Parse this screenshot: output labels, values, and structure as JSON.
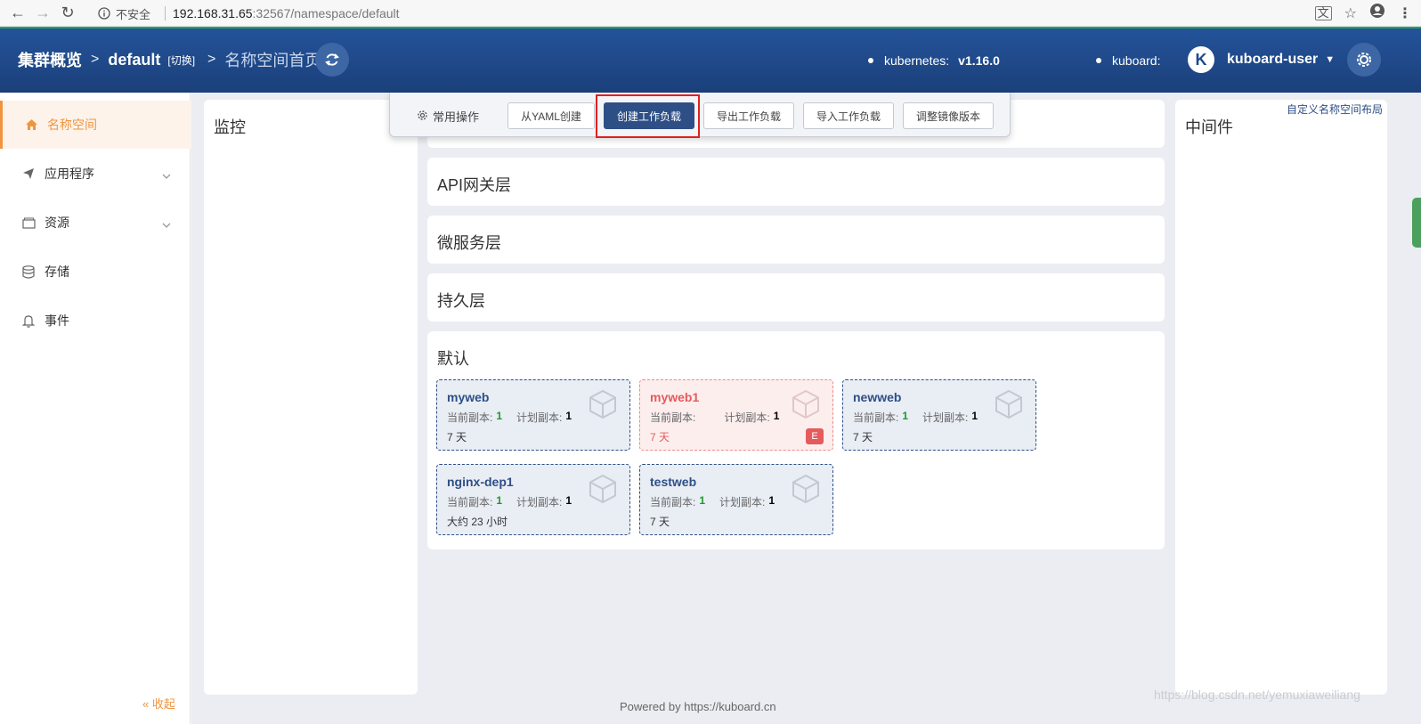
{
  "browser": {
    "security_label": "不安全",
    "url_host": "192.168.31.65",
    "url_path": ":32567/namespace/default"
  },
  "header": {
    "breadcrumb_cluster": "集群概览",
    "breadcrumb_namespace": "default",
    "switch_label": "[切换]",
    "breadcrumb_page": "名称空间首页",
    "kubernetes_label": "kubernetes:",
    "kubernetes_version": "v1.16.0",
    "kuboard_label": "kuboard:",
    "avatar_letter": "K",
    "user_name": "kuboard-user"
  },
  "sidebar": {
    "items": [
      {
        "label": "名称空间",
        "icon": "home-icon",
        "active": true
      },
      {
        "label": "应用程序",
        "icon": "send-icon",
        "has_children": true
      },
      {
        "label": "资源",
        "icon": "box-icon",
        "has_children": true
      },
      {
        "label": "存储",
        "icon": "database-icon"
      },
      {
        "label": "事件",
        "icon": "bell-icon"
      }
    ],
    "collapse_label": "« 收起"
  },
  "toolbar": {
    "label": "常用操作",
    "buttons": [
      "从YAML创建",
      "创建工作负载",
      "导出工作负载",
      "导入工作负载",
      "调整镜像版本"
    ]
  },
  "panels": {
    "monitor": "监控",
    "gateway": "API网关层",
    "microservice": "微服务层",
    "persistence": "持久层",
    "default": "默认",
    "middleware": "中间件",
    "custom_layout_link": "自定义名称空间布局"
  },
  "workloads": [
    {
      "name": "myweb",
      "current_label": "当前副本:",
      "current": "1",
      "planned_label": "计划副本:",
      "planned": "1",
      "age": "7 天",
      "error": false
    },
    {
      "name": "myweb1",
      "current_label": "当前副本:",
      "current": "",
      "planned_label": "计划副本:",
      "planned": "1",
      "age": "7 天",
      "error": true,
      "badge": "E"
    },
    {
      "name": "newweb",
      "current_label": "当前副本:",
      "current": "1",
      "planned_label": "计划副本:",
      "planned": "1",
      "age": "7 天",
      "error": false
    },
    {
      "name": "nginx-dep1",
      "current_label": "当前副本:",
      "current": "1",
      "planned_label": "计划副本:",
      "planned": "1",
      "age": "大约 23 小时",
      "error": false
    },
    {
      "name": "testweb",
      "current_label": "当前副本:",
      "current": "1",
      "planned_label": "计划副本:",
      "planned": "1",
      "age": "7 天",
      "error": false
    }
  ],
  "footer": "Powered by https://kuboard.cn",
  "watermark": "https://blog.csdn.net/yemuxiaweiliang",
  "colors": {
    "header": "#1e4a8c",
    "accent": "#f0953e",
    "primary": "#2e4f86",
    "error": "#e55b5b",
    "success": "#1c9a2a"
  }
}
